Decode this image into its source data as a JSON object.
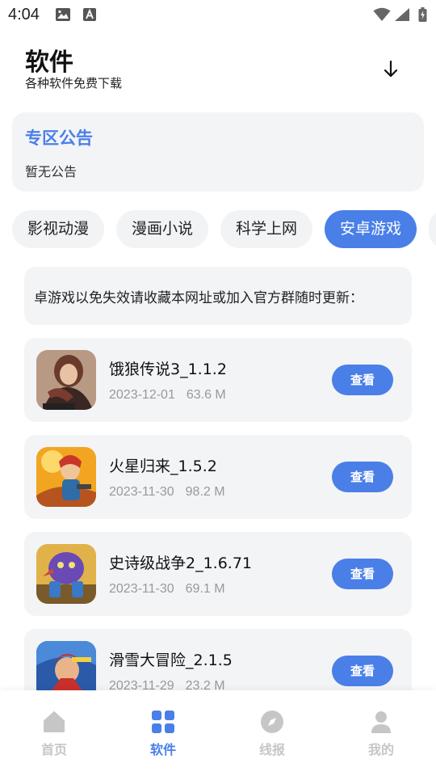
{
  "status_bar": {
    "time": "4:04"
  },
  "header": {
    "title": "软件",
    "subtitle": "各种软件免费下载"
  },
  "notice": {
    "title": "专区公告",
    "body": "暂无公告"
  },
  "tabs": [
    {
      "label": "影视动漫",
      "active": false
    },
    {
      "label": "漫画小说",
      "active": false
    },
    {
      "label": "科学上网",
      "active": false
    },
    {
      "label": "安卓游戏",
      "active": true
    }
  ],
  "marquee": {
    "text": "卓游戏以免失效请收藏本网址或加入官方群随时更新："
  },
  "apps": [
    {
      "name": "饿狼传说3_1.1.2",
      "date": "2023-12-01",
      "size": "63.6 M",
      "button": "查看"
    },
    {
      "name": "火星归来_1.5.2",
      "date": "2023-11-30",
      "size": "98.2 M",
      "button": "查看"
    },
    {
      "name": "史诗级战争2_1.6.71",
      "date": "2023-11-30",
      "size": "69.1 M",
      "button": "查看"
    },
    {
      "name": "滑雪大冒险_2.1.5",
      "date": "2023-11-29",
      "size": "23.2 M",
      "button": "查看"
    }
  ],
  "bottom_nav": [
    {
      "label": "首页",
      "icon": "home-icon",
      "active": false
    },
    {
      "label": "软件",
      "icon": "grid-icon",
      "active": true
    },
    {
      "label": "线报",
      "icon": "compass-icon",
      "active": false
    },
    {
      "label": "我的",
      "icon": "user-icon",
      "active": false
    }
  ],
  "colors": {
    "accent": "#4a7fe8",
    "card_bg": "#f3f4f6",
    "inactive_nav": "#c6c6c6"
  }
}
